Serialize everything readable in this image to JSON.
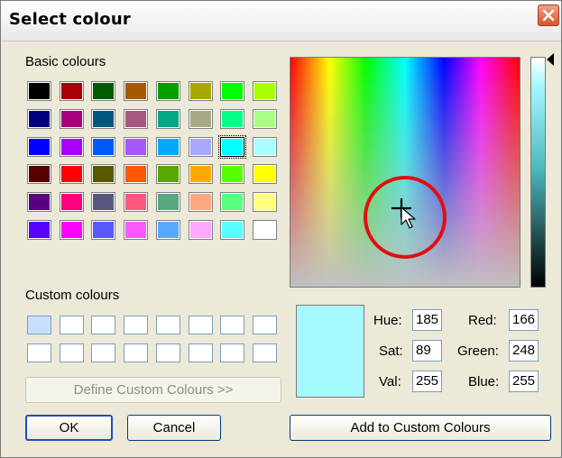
{
  "window": {
    "title": "Select colour"
  },
  "basic": {
    "label": "Basic colours",
    "rows": [
      [
        "#000000",
        "#a80000",
        "#005a00",
        "#a65a00",
        "#00a000",
        "#a8a800",
        "#00ff00",
        "#a8ff00"
      ],
      [
        "#00007f",
        "#a8007f",
        "#00587f",
        "#a8587f",
        "#00a884",
        "#a8a884",
        "#00ff84",
        "#a8ff84"
      ],
      [
        "#0000ff",
        "#a800ff",
        "#0058ff",
        "#a858ff",
        "#00a8ff",
        "#a8a8ff",
        "#00ffff",
        "#a8ffff"
      ],
      [
        "#580000",
        "#ff0000",
        "#585800",
        "#ff5800",
        "#58a800",
        "#ffa800",
        "#58ff00",
        "#ffff00"
      ],
      [
        "#58007f",
        "#ff007f",
        "#58587f",
        "#ff587f",
        "#58a87f",
        "#ffa87f",
        "#58ff7f",
        "#ffff7f"
      ],
      [
        "#5800ff",
        "#ff00ff",
        "#5858ff",
        "#ff58ff",
        "#58a8ff",
        "#ffa8ff",
        "#58ffff",
        "#ffffff"
      ]
    ],
    "selected_row": 2,
    "selected_col": 6
  },
  "custom": {
    "label": "Custom colours",
    "colors": [
      "#c8e0ff",
      "#ffffff",
      "#ffffff",
      "#ffffff",
      "#ffffff",
      "#ffffff",
      "#ffffff",
      "#ffffff",
      "#ffffff",
      "#ffffff",
      "#ffffff",
      "#ffffff",
      "#ffffff",
      "#ffffff",
      "#ffffff",
      "#ffffff"
    ]
  },
  "buttons": {
    "define": "Define Custom Colours >>",
    "ok": "OK",
    "cancel": "Cancel",
    "add": "Add to Custom Colours"
  },
  "preview_color": "#a6f8ff",
  "fields": {
    "hue_label": "Hue:",
    "hue": "185",
    "sat_label": "Sat:",
    "sat": "89",
    "val_label": "Val:",
    "val": "255",
    "red_label": "Red:",
    "red": "166",
    "green_label": "Green:",
    "green": "248",
    "blue_label": "Blue:",
    "blue": "255"
  },
  "icons": {
    "close": "close-icon",
    "crosshair": "crosshair-icon",
    "cursor": "arrow-cursor-icon",
    "slider_arrow": "slider-arrow-icon"
  },
  "colors": {
    "highlight_circle": "#e01010",
    "default_button_border": "#1c4fbf"
  }
}
